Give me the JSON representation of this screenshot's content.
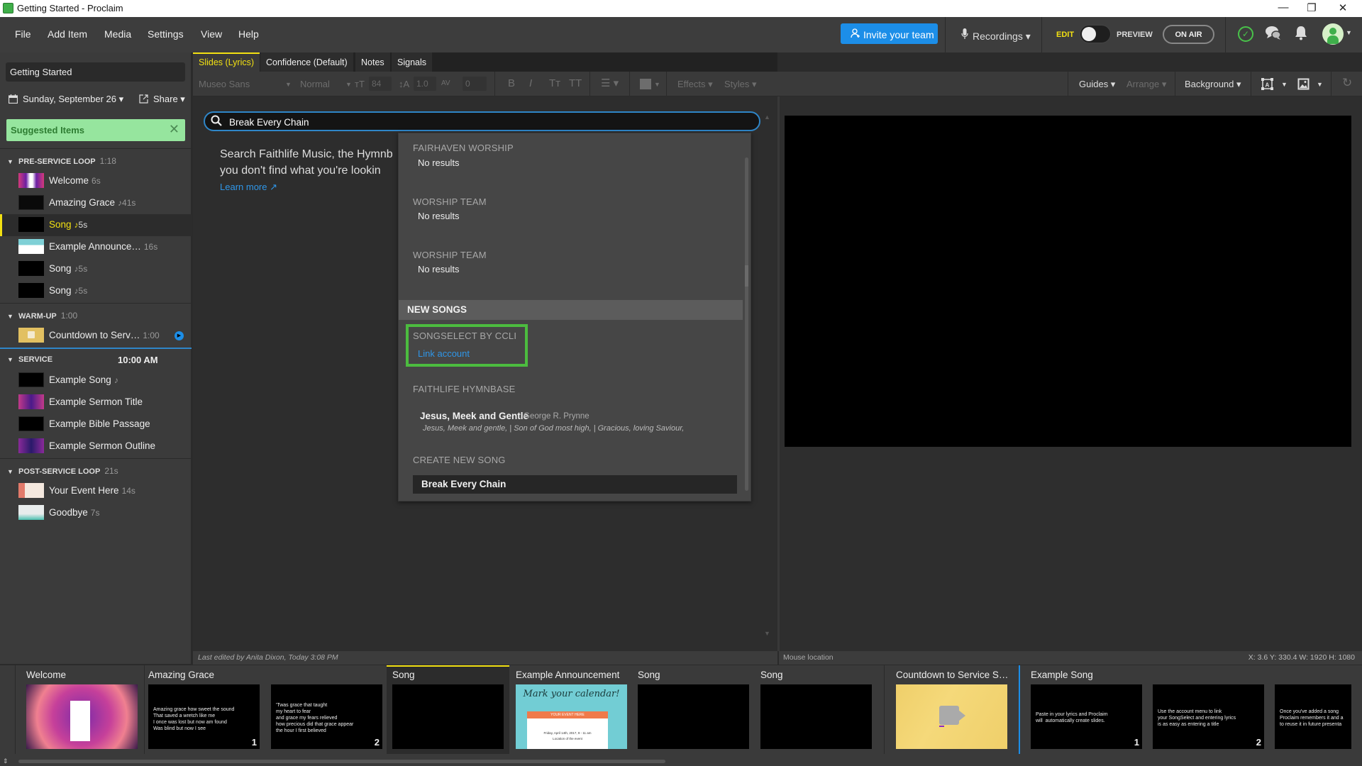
{
  "window": {
    "title": "Getting Started - Proclaim",
    "minimize_glyph": "—",
    "restore_glyph": "❐",
    "close_glyph": "✕"
  },
  "menu": {
    "items": [
      "File",
      "Add Item",
      "Media",
      "Settings",
      "View",
      "Help"
    ],
    "invite_label": "Invite your team",
    "recordings_label": "Recordings ▾",
    "edit_label": "EDIT",
    "preview_label": "PREVIEW",
    "on_air_label": "ON AIR",
    "mode_toggle_state": "edit"
  },
  "sidebar": {
    "presentation_title": "Getting Started",
    "date_label": "Sunday, September 26 ▾",
    "share_label": "Share ▾",
    "suggested_label": "Suggested Items",
    "sections": [
      {
        "name": "PRE-SERVICE LOOP",
        "duration": "1:18",
        "items": [
          {
            "title": "Welcome",
            "duration": "6s",
            "music": false
          },
          {
            "title": "Amazing Grace",
            "duration": "41s",
            "music": true
          },
          {
            "title": "Song",
            "duration": "5s",
            "music": true,
            "selected": true
          },
          {
            "title": "Example Announce…",
            "duration": "16s",
            "music": false
          },
          {
            "title": "Song",
            "duration": "5s",
            "music": true
          },
          {
            "title": "Song",
            "duration": "5s",
            "music": true
          }
        ]
      },
      {
        "name": "WARM-UP",
        "duration": "1:00",
        "items": [
          {
            "title": "Countdown to Serv…",
            "duration": "1:00",
            "music": false,
            "playing": true
          }
        ]
      },
      {
        "name": "SERVICE",
        "time": "10:00 AM",
        "items": [
          {
            "title": "Example Song",
            "duration": "",
            "music": true
          },
          {
            "title": "Example Sermon Title",
            "duration": ""
          },
          {
            "title": "Example Bible Passage",
            "duration": ""
          },
          {
            "title": "Example Sermon Outline",
            "duration": ""
          }
        ]
      },
      {
        "name": "POST-SERVICE LOOP",
        "duration": "21s",
        "items": [
          {
            "title": "Your Event Here",
            "duration": "14s"
          },
          {
            "title": "Goodbye",
            "duration": "7s"
          }
        ]
      }
    ]
  },
  "tabs": [
    "Slides (Lyrics)",
    "Confidence (Default)",
    "Notes",
    "Signals"
  ],
  "active_tab": "Slides (Lyrics)",
  "toolbar": {
    "font": "Museo Sans",
    "weight": "Normal",
    "font_size": "84",
    "line_height": "1.0",
    "spacing": "0",
    "bold": "B",
    "italic": "I",
    "small_caps": "Tт",
    "all_caps": "TT",
    "effects": "Effects ▾",
    "styles": "Styles ▾",
    "guides": "Guides ▾",
    "arrange": "Arrange ▾",
    "background": "Background ▾"
  },
  "search": {
    "value": "Break Every Chain",
    "help_text_line1": "Search Faithlife Music, the Hymnb",
    "help_text_line2": "you don't find what you're lookin",
    "learn_more": "Learn more ↗"
  },
  "dropdown": {
    "sources": [
      {
        "name": "FAIRHAVEN WORSHIP",
        "result": "No results"
      },
      {
        "name": "WORSHIP TEAM",
        "result": "No results"
      },
      {
        "name": "WORSHIP TEAM",
        "result": "No results"
      }
    ],
    "new_songs_header": "NEW SONGS",
    "ccli_label": "SONGSELECT BY CCLI",
    "link_account": "Link account",
    "hymnbase_label": "FAITHLIFE HYMNBASE",
    "hymn": {
      "title": "Jesus, Meek and Gentle",
      "author": "George R. Prynne",
      "lyrics": "Jesus, Meek and gentle, | Son of God most high, | Gracious, loving Saviour,"
    },
    "create_label": "CREATE NEW SONG",
    "create_value": "Break Every Chain"
  },
  "status": {
    "last_edited": "Last edited by Anita Dixon, Today 3:08 PM",
    "mouse_location": "Mouse location",
    "coords": "X: 3.6  Y: 330.4   W: 1920  H: 1080"
  },
  "strip": {
    "groups": [
      {
        "title": "Welcome"
      },
      {
        "title": "Amazing Grace",
        "slides": [
          {
            "num": "1",
            "text": "Amazing grace how sweet the sound\nThat saved a wretch like me\nI once was lost but now am found\nWas blind but now I see"
          },
          {
            "num": "2",
            "text": "'Twas grace that taught\nmy heart to fear\nand grace my fears relieved\nhow precious did that grace appear\nthe hour I first believed"
          }
        ]
      },
      {
        "title": "Song"
      },
      {
        "title": "Example Announcement",
        "announcement": {
          "headline": "Mark your calendar!",
          "event": "YOUR EVENT HERE",
          "date": "Friday, April 14th, 2017, 9 - 11 am",
          "location": "Location of the event"
        }
      },
      {
        "title": "Song"
      },
      {
        "title": "Song"
      },
      {
        "title": "Countdown to Service S…"
      },
      {
        "title": "Example Song",
        "slides": [
          {
            "num": "1",
            "text": "Paste in your lyrics and Proclaim\nwill  automatically create slides."
          },
          {
            "num": "2",
            "text": "Use the account menu to link\nyour SongSelect and entering lyrics\nis as easy as entering a title"
          },
          {
            "num": "",
            "text": "Once you've added a song\nProclaim remembers it and a\nto reuse it in future presenta"
          }
        ]
      }
    ]
  },
  "colors": {
    "accent_yellow": "#f2e012",
    "accent_blue": "#1c8ee8",
    "suggested_green": "#96e59e",
    "highlight_green": "#4cbc3f"
  }
}
